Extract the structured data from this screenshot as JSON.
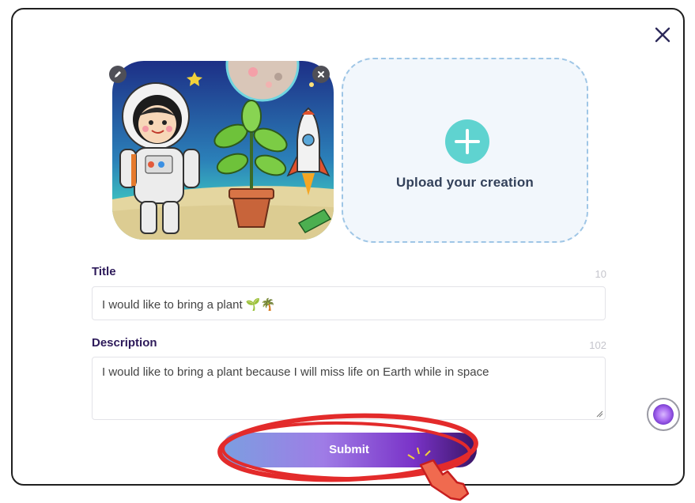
{
  "colors": {
    "accent_teal": "#5fd3d0",
    "label_purple": "#2d1a5a",
    "highlight_red": "#e32b2b"
  },
  "icons": {
    "close": "close-icon",
    "edit": "pencil-icon",
    "remove": "remove-icon",
    "plus": "plus-icon",
    "chat": "chat-assistant-icon",
    "cursor": "hand-pointer-icon"
  },
  "upload": {
    "label": "Upload your creation"
  },
  "form": {
    "title_label": "Title",
    "title_counter": "10",
    "title_value": "I would like to bring a plant 🌱🌴",
    "description_label": "Description",
    "description_counter": "102",
    "description_value": "I would like to bring a plant because I will miss life on Earth while in space"
  },
  "actions": {
    "submit_label": "Submit"
  }
}
